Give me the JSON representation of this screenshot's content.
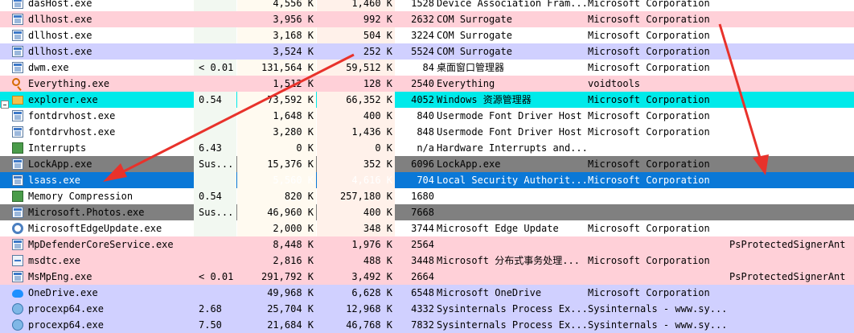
{
  "accent_color": "#e8322b",
  "row_colors": {
    "service": "#ffd0d8",
    "own_process": "#d0d0ff",
    "suspended": "#808080",
    "immersive": "#00eaea",
    "selected": "#0a78d7"
  },
  "processes": [
    {
      "name": "dasHost.exe",
      "cpu": "",
      "private_bytes": "4,556 K",
      "working_set": "1,460 K",
      "pid": "1528",
      "description": "Device Association Fram...",
      "company": "Microsoft Corporation",
      "protection": "",
      "style": "plain",
      "icon": "window-icon"
    },
    {
      "name": "dllhost.exe",
      "cpu": "",
      "private_bytes": "3,956 K",
      "working_set": "992 K",
      "pid": "2632",
      "description": "COM Surrogate",
      "company": "Microsoft Corporation",
      "protection": "",
      "style": "svc",
      "icon": "window-icon"
    },
    {
      "name": "dllhost.exe",
      "cpu": "",
      "private_bytes": "3,168 K",
      "working_set": "504 K",
      "pid": "3224",
      "description": "COM Surrogate",
      "company": "Microsoft Corporation",
      "protection": "",
      "style": "plain",
      "icon": "window-icon"
    },
    {
      "name": "dllhost.exe",
      "cpu": "",
      "private_bytes": "3,524 K",
      "working_set": "252 K",
      "pid": "5524",
      "description": "COM Surrogate",
      "company": "Microsoft Corporation",
      "protection": "",
      "style": "proc",
      "icon": "window-icon"
    },
    {
      "name": "dwm.exe",
      "cpu": "< 0.01",
      "private_bytes": "131,564 K",
      "working_set": "59,512 K",
      "pid": "84",
      "description": "桌面窗口管理器",
      "company": "Microsoft Corporation",
      "protection": "",
      "style": "plain",
      "icon": "window-icon"
    },
    {
      "name": "Everything.exe",
      "cpu": "",
      "private_bytes": "1,512 K",
      "working_set": "128 K",
      "pid": "2540",
      "description": "Everything",
      "company": "voidtools",
      "protection": "",
      "style": "svc",
      "icon": "search-icon"
    },
    {
      "name": "explorer.exe",
      "cpu": "0.54",
      "private_bytes": "73,592 K",
      "working_set": "66,352 K",
      "pid": "4052",
      "description": "Windows 资源管理器",
      "company": "Microsoft Corporation",
      "protection": "",
      "style": "imm",
      "icon": "folder-icon"
    },
    {
      "name": "fontdrvhost.exe",
      "cpu": "",
      "private_bytes": "1,648 K",
      "working_set": "400 K",
      "pid": "840",
      "description": "Usermode Font Driver Host",
      "company": "Microsoft Corporation",
      "protection": "",
      "style": "plain",
      "icon": "window-icon"
    },
    {
      "name": "fontdrvhost.exe",
      "cpu": "",
      "private_bytes": "3,280 K",
      "working_set": "1,436 K",
      "pid": "848",
      "description": "Usermode Font Driver Host",
      "company": "Microsoft Corporation",
      "protection": "",
      "style": "plain",
      "icon": "window-icon"
    },
    {
      "name": "Interrupts",
      "cpu": "6.43",
      "private_bytes": "0 K",
      "working_set": "0 K",
      "pid": "n/a",
      "description": "Hardware Interrupts and...",
      "company": "",
      "protection": "",
      "style": "plain",
      "icon": "system-icon"
    },
    {
      "name": "LockApp.exe",
      "cpu": "Sus...",
      "private_bytes": "15,376 K",
      "working_set": "352 K",
      "pid": "6096",
      "description": "LockApp.exe",
      "company": "Microsoft Corporation",
      "protection": "",
      "style": "susp",
      "icon": "window-icon"
    },
    {
      "name": "lsass.exe",
      "cpu": "",
      "private_bytes": "5,560 K",
      "working_set": "4,616 K",
      "pid": "704",
      "description": "Local Security Authorit...",
      "company": "Microsoft Corporation",
      "protection": "",
      "style": "sel",
      "icon": "window-icon"
    },
    {
      "name": "Memory Compression",
      "cpu": "0.54",
      "private_bytes": "820 K",
      "working_set": "257,180 K",
      "pid": "1680",
      "description": "",
      "company": "",
      "protection": "",
      "style": "plain",
      "icon": "system-icon"
    },
    {
      "name": "Microsoft.Photos.exe",
      "cpu": "Sus...",
      "private_bytes": "46,960 K",
      "working_set": "400 K",
      "pid": "7668",
      "description": "",
      "company": "",
      "protection": "",
      "style": "susp",
      "icon": "window-icon"
    },
    {
      "name": "MicrosoftEdgeUpdate.exe",
      "cpu": "",
      "private_bytes": "2,000 K",
      "working_set": "348 K",
      "pid": "3744",
      "description": "Microsoft Edge Update",
      "company": "Microsoft Corporation",
      "protection": "",
      "style": "plain",
      "icon": "gear-icon"
    },
    {
      "name": "MpDefenderCoreService.exe",
      "cpu": "",
      "private_bytes": "8,448 K",
      "working_set": "1,976 K",
      "pid": "2564",
      "description": "",
      "company": "",
      "protection": "PsProtectedSignerAnt",
      "style": "svc",
      "icon": "window-icon"
    },
    {
      "name": "msdtc.exe",
      "cpu": "",
      "private_bytes": "2,816 K",
      "working_set": "488 K",
      "pid": "3448",
      "description": "Microsoft 分布式事务处理...",
      "company": "Microsoft Corporation",
      "protection": "",
      "style": "svc",
      "icon": "network-icon"
    },
    {
      "name": "MsMpEng.exe",
      "cpu": "< 0.01",
      "private_bytes": "291,792 K",
      "working_set": "3,492 K",
      "pid": "2664",
      "description": "",
      "company": "",
      "protection": "PsProtectedSignerAnt",
      "style": "svc",
      "icon": "window-icon"
    },
    {
      "name": "OneDrive.exe",
      "cpu": "",
      "private_bytes": "49,968 K",
      "working_set": "6,628 K",
      "pid": "6548",
      "description": "Microsoft OneDrive",
      "company": "Microsoft Corporation",
      "protection": "",
      "style": "proc",
      "icon": "cloud-icon"
    },
    {
      "name": "procexp64.exe",
      "cpu": "2.68",
      "private_bytes": "25,704 K",
      "working_set": "12,968 K",
      "pid": "4332",
      "description": "Sysinternals Process Ex...",
      "company": "Sysinternals - www.sy...",
      "protection": "",
      "style": "proc",
      "icon": "globe-icon"
    },
    {
      "name": "procexp64.exe",
      "cpu": "7.50",
      "private_bytes": "21,684 K",
      "working_set": "46,768 K",
      "pid": "7832",
      "description": "Sysinternals Process Ex...",
      "company": "Sysinternals - www.sy...",
      "protection": "",
      "style": "proc",
      "icon": "globe-icon"
    }
  ]
}
